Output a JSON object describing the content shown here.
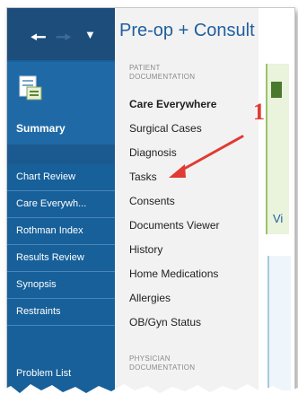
{
  "nav": {
    "back_icon": "arrow-left-icon",
    "forward_icon": "arrow-right-icon",
    "dropdown_icon": "chevron-down-icon"
  },
  "sidebar": {
    "summary_label": "Summary",
    "items": [
      "Chart Review",
      "Care Everywh...",
      "Rothman Index",
      "Results Review",
      "Synopsis",
      "Restraints",
      "Problem List"
    ]
  },
  "menu": {
    "title": "Pre-op + Consult",
    "section_patient": [
      "PATIENT",
      "DOCUMENTATION"
    ],
    "patient_items": [
      "Care Everywhere",
      "Surgical Cases",
      "Diagnosis",
      "Tasks",
      "Consents",
      "Documents Viewer",
      "History",
      "Home Medications",
      "Allergies",
      "OB/Gyn Status"
    ],
    "section_physician": [
      "PHYSICIAN",
      "DOCUMENTATION"
    ]
  },
  "content": {
    "partial_text": "Vi"
  },
  "annotation": {
    "number": "1"
  },
  "colors": {
    "sidebar": "#17609a",
    "accent": "#1f5f9e",
    "annotation": "#e03a33"
  }
}
